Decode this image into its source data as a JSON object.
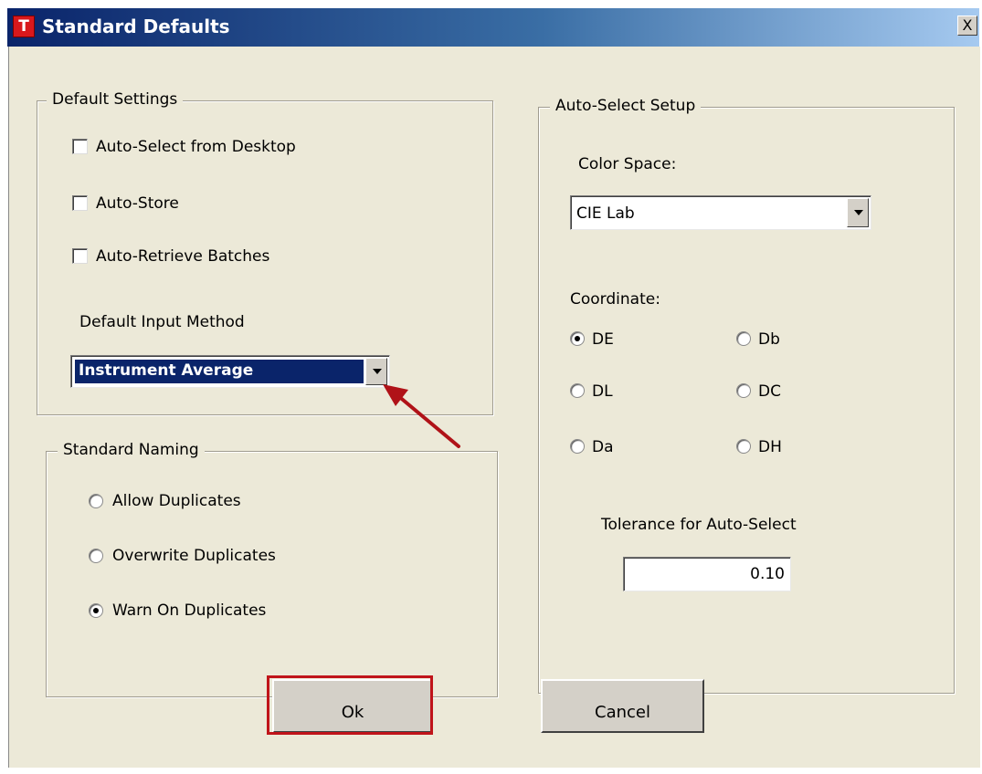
{
  "window": {
    "app_icon_letter": "T",
    "title": "Standard Defaults",
    "close_label": "X"
  },
  "default_settings": {
    "legend": "Default Settings",
    "checkboxes": [
      {
        "label": "Auto-Select from Desktop",
        "checked": false
      },
      {
        "label": "Auto-Store",
        "checked": false
      },
      {
        "label": "Auto-Retrieve Batches",
        "checked": false
      }
    ],
    "input_method_label": "Default Input Method",
    "input_method_value": "Instrument Average"
  },
  "standard_naming": {
    "legend": "Standard Naming",
    "options": [
      {
        "label": "Allow Duplicates",
        "selected": false
      },
      {
        "label": "Overwrite Duplicates",
        "selected": false
      },
      {
        "label": "Warn On Duplicates",
        "selected": true
      }
    ]
  },
  "auto_select": {
    "legend": "Auto-Select Setup",
    "color_space_label": "Color Space:",
    "color_space_value": "CIE Lab",
    "coordinate_label": "Coordinate:",
    "coordinates": [
      {
        "label": "DE",
        "selected": true
      },
      {
        "label": "Db",
        "selected": false
      },
      {
        "label": "DL",
        "selected": false
      },
      {
        "label": "DC",
        "selected": false
      },
      {
        "label": "Da",
        "selected": false
      },
      {
        "label": "DH",
        "selected": false
      }
    ],
    "tolerance_label": "Tolerance for Auto-Select",
    "tolerance_value": "0.10"
  },
  "buttons": {
    "ok": "Ok",
    "cancel": "Cancel"
  },
  "colors": {
    "dialog_face": "#ece9d8",
    "title_gradient_start": "#0a246a",
    "annotation_arrow": "#b01218",
    "selection": "#0a246a"
  }
}
